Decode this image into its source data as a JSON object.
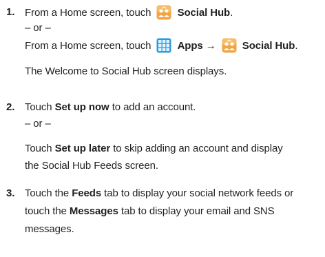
{
  "steps": [
    {
      "number": "1.",
      "lines": {
        "l1_pre": "From a Home screen, touch",
        "l1_bold": "Social Hub",
        "l1_post": ".",
        "or": "– or –",
        "l3_pre": "From a Home screen, touch",
        "l3_apps": "Apps →",
        "l3_bold": "Social Hub",
        "l3_post": ".",
        "l4": "The Welcome to Social Hub screen displays."
      }
    },
    {
      "number": "2.",
      "lines": {
        "l1_pre": "Touch",
        "l1_bold": "Set up now",
        "l1_post": "to add an account.",
        "or": "– or –",
        "l3_pre": "Touch",
        "l3_bold": "Set up later",
        "l3_post": "to skip adding an account and display",
        "l4": "the Social Hub Feeds screen."
      }
    },
    {
      "number": "3.",
      "lines": {
        "l1_pre": "Touch the",
        "l1_bold": "Feeds",
        "l1_post": "tab to display your social network feeds or",
        "l2_pre": "touch the",
        "l2_bold": "Messages",
        "l2_post": "tab to display your email and SNS",
        "l3": "messages."
      }
    }
  ],
  "icons": {
    "social_hub": "social-hub-icon",
    "apps": "apps-grid-icon",
    "social_hub_color": "#f0a23a",
    "apps_color": "#1f8fd6"
  }
}
